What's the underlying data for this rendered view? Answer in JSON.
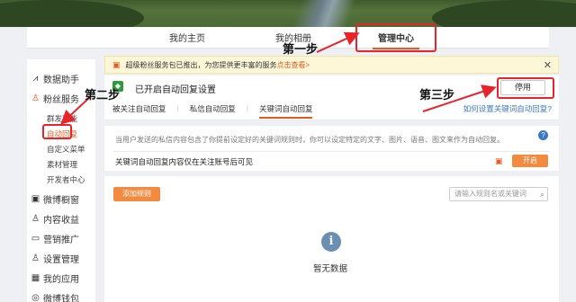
{
  "topnav": {
    "tabs": [
      {
        "label": "我的主页"
      },
      {
        "label": "我的相册"
      },
      {
        "label": "管理中心"
      }
    ]
  },
  "sidebar": {
    "items": [
      {
        "label": "数据助手",
        "icon": "trend-icon"
      },
      {
        "label": "粉丝服务",
        "icon": "user-icon"
      },
      {
        "label": "微博橱窗",
        "icon": "shop-icon"
      },
      {
        "label": "内容收益",
        "icon": "income-icon"
      },
      {
        "label": "营销推广",
        "icon": "promo-icon"
      },
      {
        "label": "设置管理",
        "icon": "settings-icon"
      },
      {
        "label": "我的应用",
        "icon": "apps-icon"
      },
      {
        "label": "微博钱包",
        "icon": "wallet-icon"
      }
    ],
    "subitems": [
      "群发功能",
      "自动回复",
      "自定义菜单",
      "素材管理",
      "开发者中心"
    ]
  },
  "notice": {
    "text": "超级粉丝服务包已推出，为您提供更丰富的服务",
    "link": "点击查看>"
  },
  "panel1": {
    "status": "已开启自动回复设置",
    "stop_label": "停用",
    "tabs": [
      "被关注自动回复",
      "私信自动回复",
      "关键词自动回复"
    ],
    "help_link": "如何设置关键词自动回复?"
  },
  "panel2": {
    "desc": "当用户发送的私信内容包含了你提前设定好的关键词规则时，你可以设定特定的文字、图片、语音、图文来作为自动回复。",
    "keyword_note": "关键词自动回复内容仅在关注账号后可见",
    "start_label": "开启"
  },
  "panel3": {
    "add_label": "添加规则",
    "search_placeholder": "请输入规则名或关键词",
    "empty": "暂无数据"
  },
  "annotations": {
    "step1": "第一步",
    "step2": "第二步",
    "step3": "第三步"
  },
  "colors": {
    "accent": "#e55a1f",
    "annotation": "#e8242b",
    "link": "#3a78c4"
  }
}
